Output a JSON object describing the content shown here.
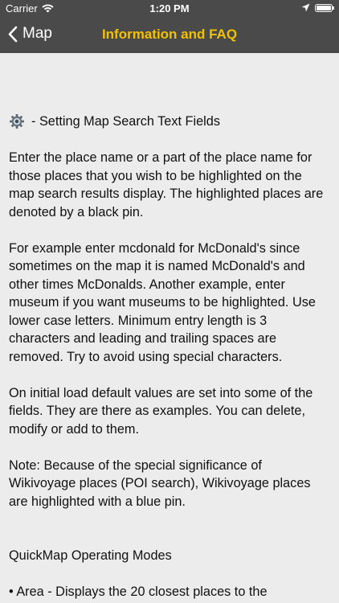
{
  "status_bar": {
    "carrier": "Carrier",
    "time": "1:20 PM"
  },
  "nav": {
    "back_label": "Map",
    "title": "Information and FAQ",
    "title_color": "#f2c200",
    "bar_color": "#4a4a4a"
  },
  "content": {
    "section_title": "- Setting Map Search Text Fields",
    "paragraphs": [
      "Enter the place name or a part of the place name for those places that you wish to be highlighted on the map search results display. The highlighted places are denoted by a black pin.",
      "For example enter mcdonald for McDonald's since sometimes on the map it is named McDonald's and other times McDonalds. Another example, enter museum if you want museums to be highlighted. Use lower case letters. Minimum entry length is 3 characters and leading and trailing spaces are removed. Try to avoid using special characters.",
      "On initial load default values are set into some of the fields. They are there as examples. You can delete, modify or add to them.",
      "Note: Because of the special significance of Wikivoyage places (POI search), Wikivoyage places are highlighted with a blue pin."
    ],
    "modes_heading": "QuickMap Operating Modes",
    "bullet_1": "• Area - Displays the 20 closest places to the"
  }
}
